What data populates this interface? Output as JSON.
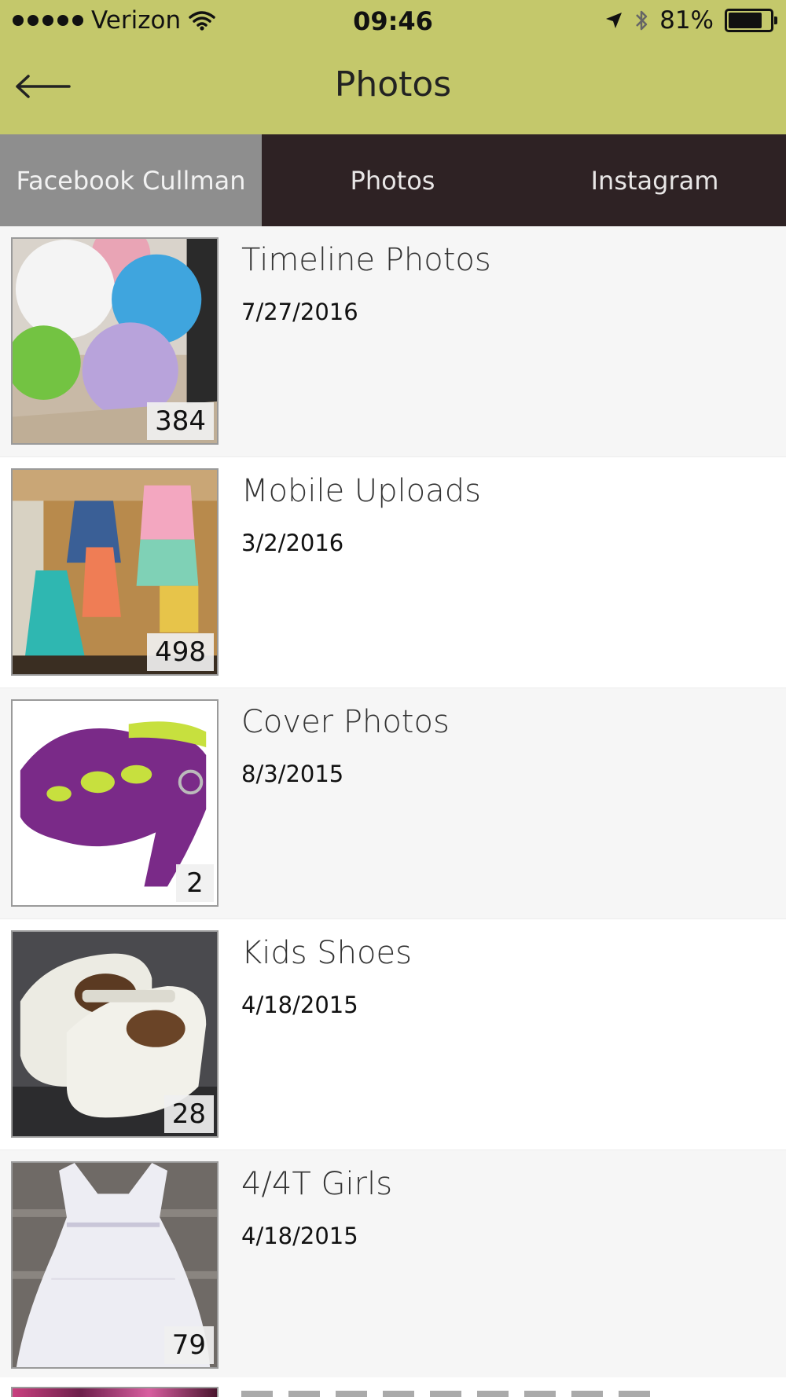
{
  "status_bar": {
    "carrier": "Verizon",
    "time": "09:46",
    "battery": "81%",
    "battery_level": 0.81
  },
  "nav": {
    "title": "Photos",
    "back_icon": "arrow-left-icon"
  },
  "tabs": [
    {
      "label": "Facebook Cullman",
      "active": true
    },
    {
      "label": "Photos",
      "active": false
    },
    {
      "label": "Instagram",
      "active": false
    }
  ],
  "albums": [
    {
      "title": "Timeline Photos",
      "date": "7/27/2016",
      "count": "384"
    },
    {
      "title": "Mobile Uploads",
      "date": "3/2/2016",
      "count": "498"
    },
    {
      "title": "Cover Photos",
      "date": "8/3/2015",
      "count": "2"
    },
    {
      "title": "Kids Shoes",
      "date": "4/18/2015",
      "count": "28"
    },
    {
      "title": "4/4T Girls",
      "date": "4/18/2015",
      "count": "79"
    }
  ],
  "colors": {
    "topbar": "#c4c86b",
    "tab_active": "#8e8e8e",
    "tab_inactive": "#2e2224"
  }
}
